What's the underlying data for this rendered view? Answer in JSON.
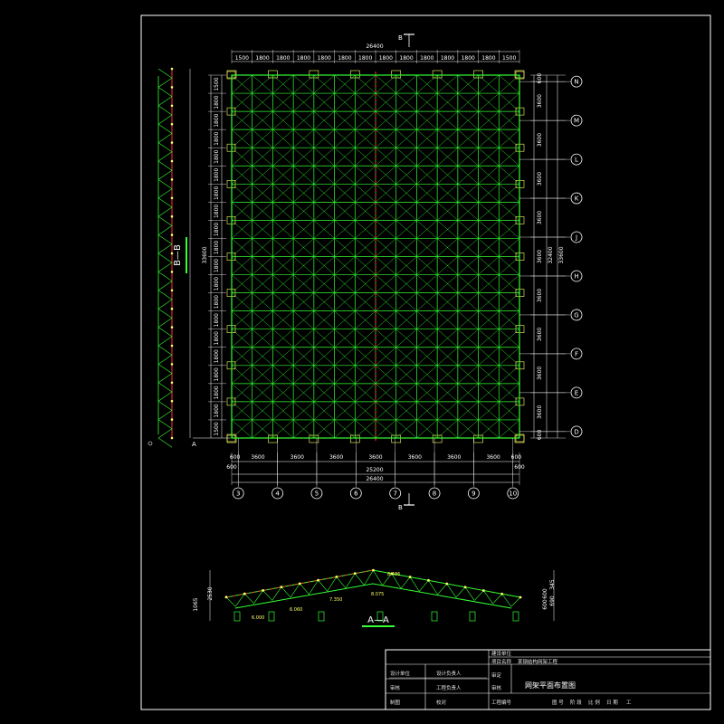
{
  "plan": {
    "top_total": "26400",
    "top_spans": [
      "1500",
      "1800",
      "1800",
      "1800",
      "1800",
      "1800",
      "1800",
      "1800",
      "1800",
      "1800",
      "1800",
      "1800",
      "1800",
      "1500"
    ],
    "bottom_spans": [
      "600",
      "3600",
      "3600",
      "3600",
      "3600",
      "3600",
      "3600",
      "3600",
      "600"
    ],
    "bottom_mid": "25200",
    "bottom_total": "26400",
    "left_spans": [
      "1500",
      "1800",
      "1800",
      "1800",
      "1800",
      "1800",
      "1800",
      "1800",
      "1800",
      "1800",
      "1800",
      "1800",
      "1800",
      "1800",
      "1800",
      "1800",
      "1800",
      "1800",
      "1800",
      "1500"
    ],
    "left_total": "33600",
    "right_spans": [
      "600",
      "3600",
      "3600",
      "3600",
      "3600",
      "3600",
      "3600",
      "3600",
      "3600",
      "3600",
      "600"
    ],
    "right_total_a": "32400",
    "right_total_b": "33600",
    "row_axes": [
      "N",
      "M",
      "L",
      "K",
      "J",
      "H",
      "G",
      "F",
      "E",
      "D"
    ],
    "col_axes": [
      "3",
      "4",
      "5",
      "6",
      "7",
      "8",
      "9",
      "10"
    ],
    "section_top": "B",
    "section_bottom": "B",
    "section_left": "A"
  },
  "side_elevation": {
    "label": "B—B"
  },
  "front_elevation": {
    "label": "A—A",
    "dims_left": [
      "2530",
      "1065"
    ],
    "dims_right": [
      "345",
      "600",
      "600",
      "690"
    ],
    "elevations": [
      "8.486",
      "8.075",
      "7.350",
      "6.060",
      "6.000"
    ]
  },
  "title_block": {
    "project_cat": "建设单位",
    "project_name_label": "项目名称",
    "project_name": "某钢结构网架工程",
    "design_unit": "设计单位",
    "design_lead": "设计负责人",
    "eng_lead": "工程负责人",
    "review": "审核",
    "approve": "审定",
    "check": "审核",
    "draw": "制图",
    "proofread": "校对",
    "design": "设计",
    "drawing_title": "网架平面布置图",
    "footer": [
      "图 号",
      "阶 段",
      "比 例",
      "日 期",
      "工"
    ],
    "eng_no": "工程编号"
  },
  "colors": {
    "background": "#000000",
    "frame": "#ffffff",
    "grid": "#33ff33",
    "center_line": "#ff3333",
    "dimension": "#ffffff",
    "support": "#ffff66"
  }
}
